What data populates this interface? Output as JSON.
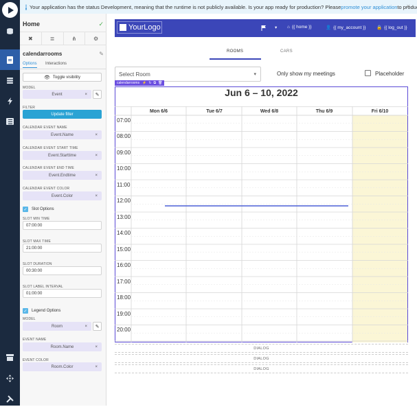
{
  "rail": {
    "items": [
      "play-icon",
      "database-icon",
      "page-icon",
      "stack-icon",
      "flash-icon",
      "list-icon",
      "store-icon",
      "move-icon",
      "tools-icon"
    ]
  },
  "banner": {
    "text_before": "Your application has the status Development, meaning that the runtime is not publicly available. Is your app ready for production? Please ",
    "link": "promote your application",
    "text_after": " to production.",
    "close": "×"
  },
  "panel": {
    "page_title": "Home",
    "component_name": "calendarrooms",
    "tabs": [
      "Options",
      "Interactions"
    ],
    "toggle_visibility": "Toggle visibility",
    "model_label": "MODEL",
    "model_value": "Event",
    "filter_label": "FILTER",
    "update_filter": "Update filter",
    "event_name_label": "CALENDAR EVENT NAME",
    "event_name_value": "Event.Name",
    "start_time_label": "CALENDAR EVENT START TIME",
    "start_time_value": "Event.Starttime",
    "end_time_label": "CALENDAR EVENT END TIME",
    "end_time_value": "Event.Endtime",
    "color_label": "CALENDAR EVENT COLOR",
    "color_value": "Event.Color",
    "slot_options": "Slot Options",
    "slot_min_label": "SLOT MIN TIME",
    "slot_min_value": "07:00:00",
    "slot_max_label": "SLOT MAX TIME",
    "slot_max_value": "21:00:00",
    "slot_duration_label": "SLOT DURATION",
    "slot_duration_value": "00:30:00",
    "slot_interval_label": "SLOT LABEL INTERVAL",
    "slot_interval_value": "01:00:00",
    "legend_options": "Legend Options",
    "legend_model_label": "MODEL",
    "legend_model_value": "Room",
    "legend_event_name_label": "EVENT NAME",
    "legend_event_name_value": "Room.Name",
    "legend_event_color_label": "EVENT COLOR",
    "legend_event_color_value": "Room.Color"
  },
  "app": {
    "logo": "YourLogo",
    "nav": {
      "home": "{{ home }}",
      "account": "{{ my_account }}",
      "logout": "{{ log_out }}"
    },
    "tabs": [
      "ROOMS",
      "CARS"
    ],
    "select_room_placeholder": "Select Room",
    "only_my_meetings": "Only show my meetings",
    "placeholder_label": "Placeholder",
    "calendar_badge": "calendarrooms",
    "calendar_title": "Jun 6 – 10, 2022",
    "days": [
      "Mon 6/6",
      "Tue 6/7",
      "Wed 6/8",
      "Thu 6/9",
      "Fri 6/10"
    ],
    "time_labels": [
      "07:00",
      "08:00",
      "09:00",
      "10:00",
      "11:00",
      "12:00",
      "13:00",
      "14:00",
      "15:00",
      "16:00",
      "17:00",
      "18:00",
      "19:00",
      "20:00"
    ],
    "dialogs": [
      "DIALOG",
      "DIALOG",
      "DIALOG"
    ]
  },
  "colors": {
    "rail": "#1b2a3f",
    "header": "#3b46b8",
    "accent": "#5ab7e8",
    "chip": "#e6e3f7",
    "today": "#fbf6d6",
    "now_line": "#4a5ed6"
  }
}
